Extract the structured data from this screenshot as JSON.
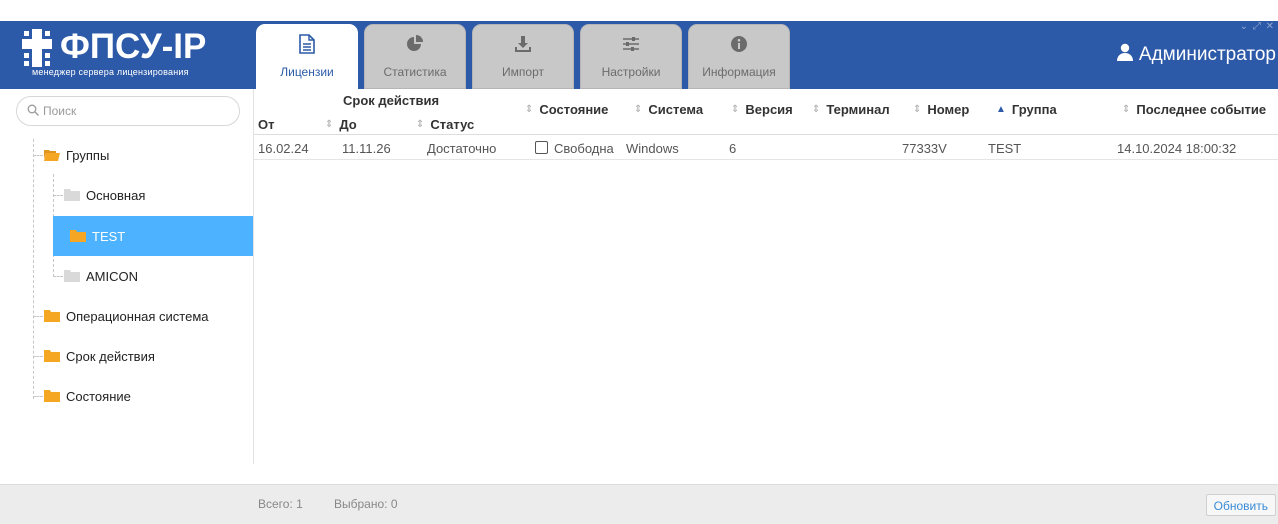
{
  "app": {
    "logo_title": "ФПСУ-IP",
    "logo_subtitle": "менеджер сервера лицензирования",
    "user_name": "Администратор"
  },
  "tabs": [
    {
      "label": "Лицензии",
      "icon": "document-icon",
      "active": true
    },
    {
      "label": "Статистика",
      "icon": "pie-chart-icon",
      "active": false
    },
    {
      "label": "Импорт",
      "icon": "download-icon",
      "active": false
    },
    {
      "label": "Настройки",
      "icon": "sliders-icon",
      "active": false
    },
    {
      "label": "Информация",
      "icon": "info-icon",
      "active": false
    }
  ],
  "search": {
    "placeholder": "Поиск"
  },
  "tree": {
    "groups": "Группы",
    "children": [
      "Основная",
      "TEST",
      "AMICON"
    ],
    "selected": "TEST",
    "os": "Операционная система",
    "validity": "Срок действия",
    "state": "Состояние"
  },
  "table": {
    "group_header": "Срок действия",
    "columns": {
      "from": "От",
      "to": "До",
      "status": "Статус",
      "state": "Состояние",
      "system": "Система",
      "version": "Версия",
      "terminal": "Терминал",
      "number": "Номер",
      "group": "Группа",
      "last_event": "Последнее событие"
    },
    "rows": [
      {
        "from": "16.02.24",
        "to": "11.11.26",
        "status": "Достаточно",
        "state": "Свободна",
        "system": "Windows",
        "version": "6",
        "terminal": "",
        "number": "77333V",
        "group": "TEST",
        "last_event": "14.10.2024 18:00:32"
      }
    ]
  },
  "footer": {
    "total_label": "Всего:",
    "total_value": "1",
    "selected_label": "Выбрано:",
    "selected_value": "0",
    "refresh": "Обновить"
  },
  "colors": {
    "header_bg": "#2c5aa8",
    "selected_node": "#4db2ff",
    "folder_open": "#f5a623",
    "folder_closed": "#d9d9d9"
  }
}
